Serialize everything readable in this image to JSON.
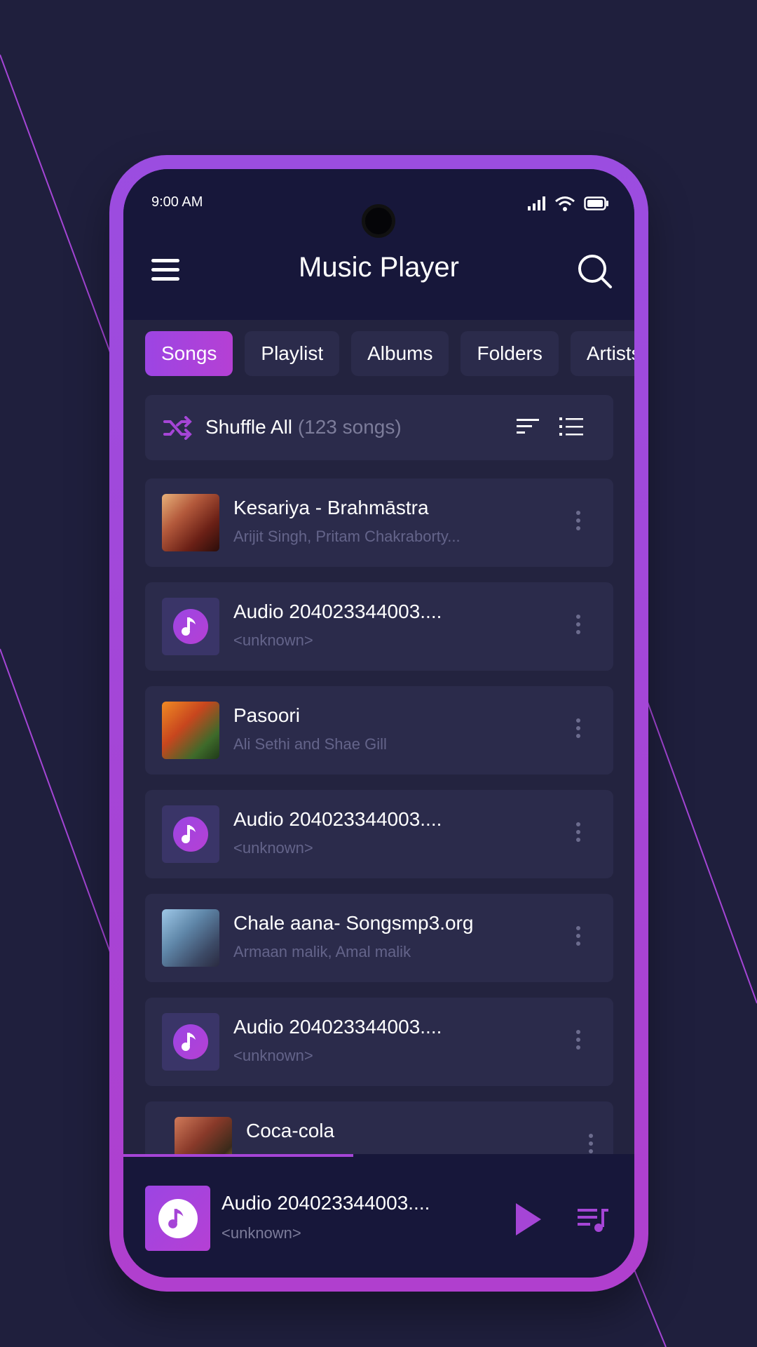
{
  "status_bar": {
    "time": "9:00 AM"
  },
  "header": {
    "title": "Music Player"
  },
  "tabs": [
    {
      "label": "Songs",
      "active": true
    },
    {
      "label": "Playlist",
      "active": false
    },
    {
      "label": "Albums",
      "active": false
    },
    {
      "label": "Folders",
      "active": false
    },
    {
      "label": "Artists",
      "active": false
    }
  ],
  "shuffle": {
    "label": "Shuffle All",
    "count": "(123 songs)"
  },
  "songs": [
    {
      "title": "Kesariya - Brahmāstra",
      "artist": "Arijit Singh, Pritam Chakraborty...",
      "artwork": "album-art"
    },
    {
      "title": "Audio 204023344003....",
      "artist": "<unknown>",
      "artwork": "music-note-icon"
    },
    {
      "title": "Pasoori",
      "artist": "Ali Sethi and Shae Gill",
      "artwork": "album-art"
    },
    {
      "title": "Audio 204023344003....",
      "artist": "<unknown>",
      "artwork": "music-note-icon"
    },
    {
      "title": "Chale aana- Songsmp3.org",
      "artist": "Armaan malik, Amal malik",
      "artwork": "album-art"
    },
    {
      "title": "Audio 204023344003....",
      "artist": "<unknown>",
      "artwork": "music-note-icon"
    },
    {
      "title": "Coca-cola",
      "artist": "",
      "artwork": "album-art"
    }
  ],
  "now_playing": {
    "title": "Audio 204023344003....",
    "artist": "<unknown>",
    "progress": 0.45
  },
  "colors": {
    "background": "#1f1f3d",
    "accent": "#a545d6",
    "card": "#2b2b4b",
    "header": "#17173a"
  }
}
